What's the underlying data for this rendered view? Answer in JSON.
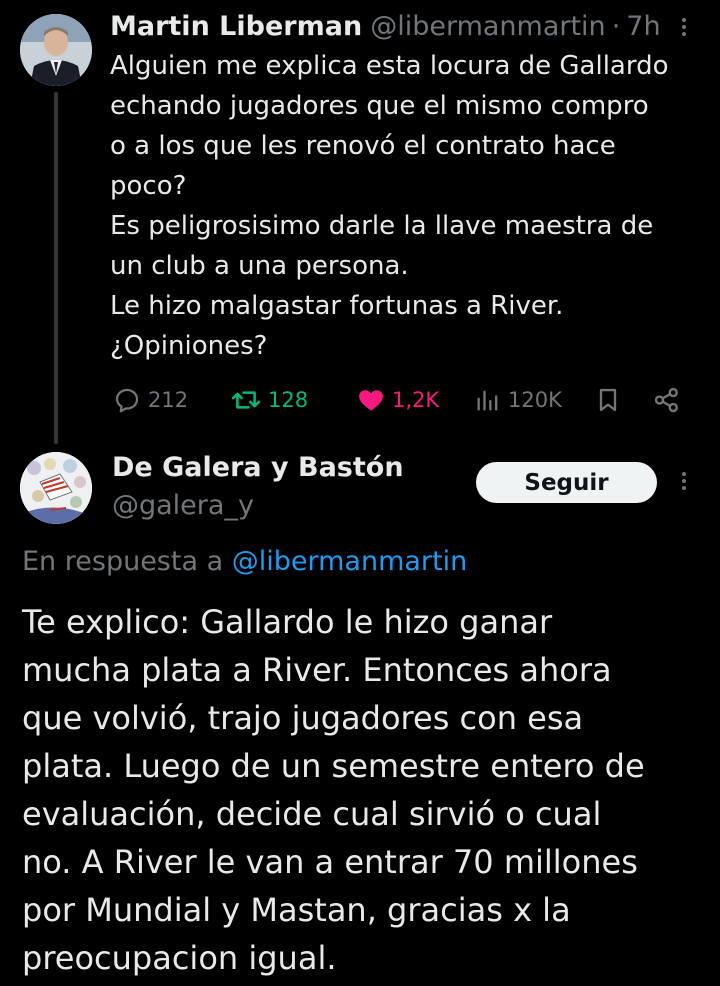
{
  "parent_tweet": {
    "author_name": "Martin Liberman",
    "handle": "@libermanmartin",
    "separator": "·",
    "time": "7h",
    "text_lines": [
      "Alguien me explica esta locura de Gallardo",
      "echando jugadores que el mismo compro",
      "o a los que les renovó el contrato hace",
      "poco?",
      "Es peligrosisimo darle la llave maestra de",
      "un club a una persona.",
      "Le hizo malgastar fortunas a River.",
      "¿Opiniones?"
    ],
    "actions": {
      "replies": "212",
      "retweets": "128",
      "likes": "1,2K",
      "views": "120K"
    },
    "icons": [
      "reply-icon",
      "retweet-icon",
      "heart-icon",
      "views-icon",
      "bookmark-icon",
      "share-icon",
      "more-icon"
    ]
  },
  "reply_tweet": {
    "author_name": "De Galera y Bastón",
    "handle": "@galera_y",
    "follow_label": "Seguir",
    "reply_prefix": "En respuesta a",
    "reply_mention": "@libermanmartin",
    "text_lines": [
      "Te explico: Gallardo le hizo ganar",
      "mucha plata a River. Entonces ahora",
      "que volvió, trajo jugadores con esa",
      "plata. Luego de un semestre entero de",
      "evaluación, decide cual sirvió o cual",
      "no. A River le van a entrar 70 millones",
      "por Mundial y Mastan, gracias x la",
      "preocupacion igual."
    ]
  },
  "colors": {
    "background": "#000000",
    "text_primary": "#e7e9ea",
    "text_secondary": "#71767b",
    "link_blue": "#1d9bf0",
    "retweet_green": "#00ba7c",
    "like_pink": "#f91880",
    "button_bg": "#eff3f4"
  }
}
